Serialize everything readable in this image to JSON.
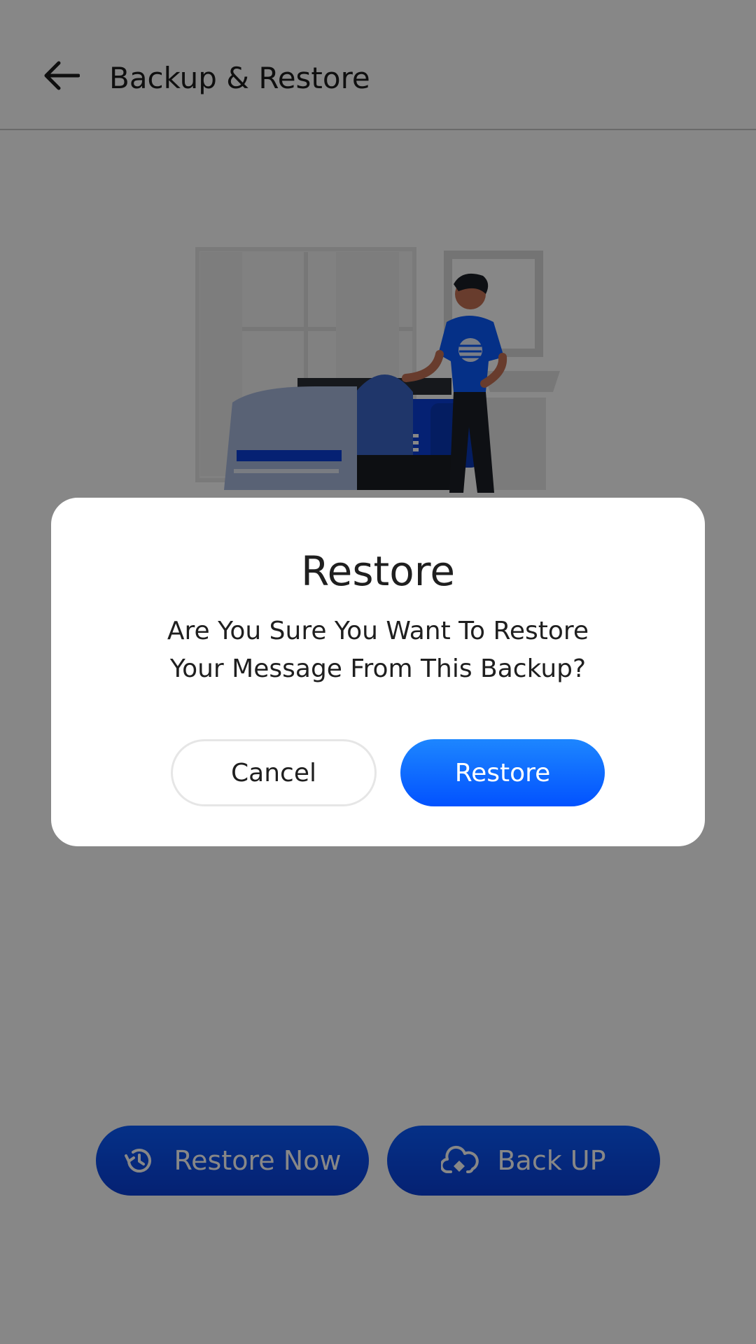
{
  "appbar": {
    "title": "Backup & Restore",
    "back_icon": "arrow-left-icon"
  },
  "actions": {
    "restore_now": {
      "label": "Restore Now",
      "icon": "history-icon"
    },
    "backup": {
      "label": "Back UP",
      "icon": "cloud-upload-icon"
    }
  },
  "dialog": {
    "title": "Restore",
    "message_line1": "Are You Sure You Want To Restore",
    "message_line2": "Your Message From This Backup?",
    "cancel_label": "Cancel",
    "confirm_label": "Restore"
  },
  "colors": {
    "primary": "#0b5cff",
    "dialog_button": "#1d86ff",
    "scrim": "rgba(0,0,0,0.47)",
    "text": "#1f1f1f"
  }
}
